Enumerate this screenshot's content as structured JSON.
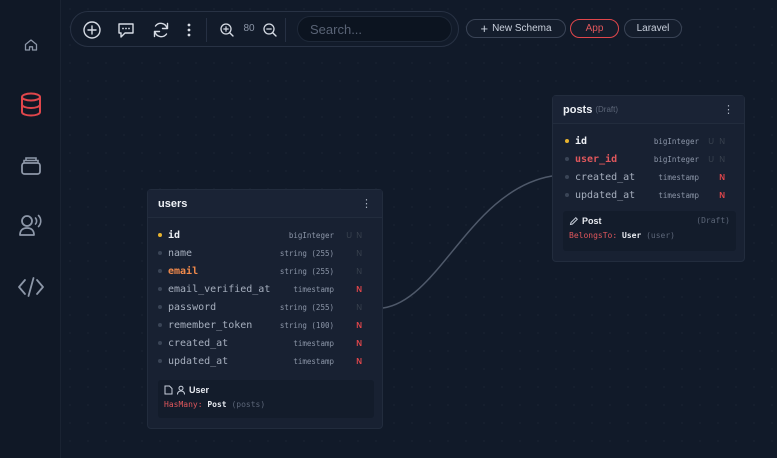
{
  "toolbar": {
    "zoom": "80",
    "search_placeholder": "Search..."
  },
  "pills": {
    "new_schema": "New Schema",
    "app": "App",
    "laravel": "Laravel"
  },
  "colors": {
    "accent": "#e0464b",
    "key": "#e8b32e",
    "highlight": "#f0894b"
  },
  "sidebar": {
    "items": [
      {
        "icon": "home-icon"
      },
      {
        "icon": "database-icon"
      },
      {
        "icon": "archive-icon"
      },
      {
        "icon": "voice-icon"
      },
      {
        "icon": "code-icon"
      }
    ]
  },
  "users": {
    "title": "users",
    "menu": "⋮",
    "columns": [
      {
        "name": "id",
        "type": "bigInteger",
        "u": "U",
        "n": "N"
      },
      {
        "name": "name",
        "type": "string (255)",
        "n": "N"
      },
      {
        "name": "email",
        "type": "string (255)",
        "n": "N"
      },
      {
        "name": "email_verified_at",
        "type": "timestamp",
        "n": "N"
      },
      {
        "name": "password",
        "type": "string (255)",
        "n": "N"
      },
      {
        "name": "remember_token",
        "type": "string (100)",
        "n": "N"
      },
      {
        "name": "created_at",
        "type": "timestamp",
        "n": "N"
      },
      {
        "name": "updated_at",
        "type": "timestamp",
        "n": "N"
      }
    ],
    "model": "User",
    "relation": {
      "kind": "HasMany",
      "model": "Post",
      "note": "(posts)"
    }
  },
  "posts": {
    "title": "posts",
    "status": "(Draft)",
    "menu": "⋮",
    "columns": [
      {
        "name": "id",
        "type": "bigInteger",
        "u": "U",
        "n": "N"
      },
      {
        "name": "user_id",
        "type": "bigInteger",
        "u": "U",
        "n": "N"
      },
      {
        "name": "created_at",
        "type": "timestamp",
        "n": "N"
      },
      {
        "name": "updated_at",
        "type": "timestamp",
        "n": "N"
      }
    ],
    "model": "Post",
    "model_status": "(Draft)",
    "relation": {
      "kind": "BelongsTo",
      "model": "User",
      "note": "(user)"
    }
  }
}
